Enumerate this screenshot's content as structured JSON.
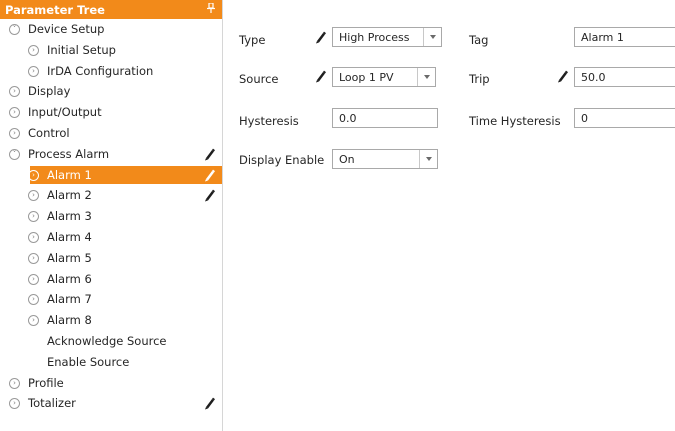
{
  "tree": {
    "title": "Parameter Tree",
    "pin_icon": "pin-icon",
    "items": [
      {
        "label": "Device Setup",
        "level": 0,
        "expander": "collapse",
        "edit": false
      },
      {
        "label": "Initial Setup",
        "level": 1,
        "expander": "expand",
        "edit": false
      },
      {
        "label": "IrDA Configuration",
        "level": 1,
        "expander": "expand",
        "edit": false
      },
      {
        "label": "Display",
        "level": 0,
        "expander": "expand",
        "edit": false
      },
      {
        "label": "Input/Output",
        "level": 0,
        "expander": "expand",
        "edit": false
      },
      {
        "label": "Control",
        "level": 0,
        "expander": "expand",
        "edit": false
      },
      {
        "label": "Process Alarm",
        "level": 0,
        "expander": "collapse",
        "edit": true
      },
      {
        "label": "Alarm 1",
        "level": 1,
        "expander": "expand",
        "edit": true,
        "selected": true
      },
      {
        "label": "Alarm 2",
        "level": 1,
        "expander": "expand",
        "edit": true
      },
      {
        "label": "Alarm 3",
        "level": 1,
        "expander": "expand",
        "edit": false
      },
      {
        "label": "Alarm 4",
        "level": 1,
        "expander": "expand",
        "edit": false
      },
      {
        "label": "Alarm 5",
        "level": 1,
        "expander": "expand",
        "edit": false
      },
      {
        "label": "Alarm 6",
        "level": 1,
        "expander": "expand",
        "edit": false
      },
      {
        "label": "Alarm 7",
        "level": 1,
        "expander": "expand",
        "edit": false
      },
      {
        "label": "Alarm 8",
        "level": 1,
        "expander": "expand",
        "edit": false
      },
      {
        "label": "Acknowledge Source",
        "level": 1,
        "expander": "none",
        "edit": false
      },
      {
        "label": "Enable Source",
        "level": 1,
        "expander": "none",
        "edit": false
      },
      {
        "label": "Profile",
        "level": 0,
        "expander": "expand",
        "edit": false
      },
      {
        "label": "Totalizer",
        "level": 0,
        "expander": "expand",
        "edit": true
      }
    ]
  },
  "form": {
    "type": {
      "label": "Type",
      "value": "High Process",
      "edited": true
    },
    "tag": {
      "label": "Tag",
      "value": "Alarm 1"
    },
    "source": {
      "label": "Source",
      "value": "Loop 1 PV",
      "edited": true
    },
    "trip": {
      "label": "Trip",
      "value": "50.0",
      "edited": true
    },
    "hysteresis": {
      "label": "Hysteresis",
      "value": "0.0"
    },
    "time_hysteresis": {
      "label": "Time Hysteresis",
      "value": "0"
    },
    "display_enable": {
      "label": "Display Enable",
      "value": "On"
    }
  },
  "colors": {
    "accent": "#f28a1a",
    "border": "#a9a9a9"
  }
}
